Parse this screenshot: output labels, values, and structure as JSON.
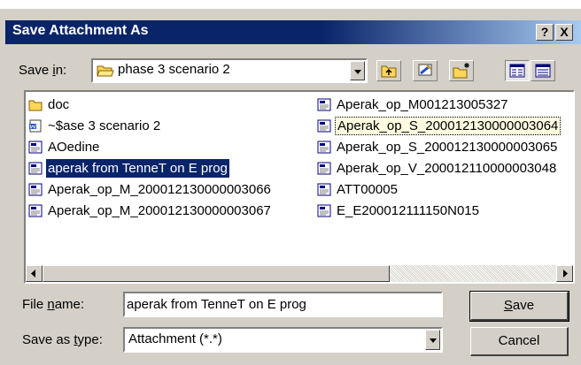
{
  "window": {
    "title": "Save Attachment As",
    "help_label": "?",
    "close_label": "X"
  },
  "save_in": {
    "label_pre": "Save ",
    "label_key": "i",
    "label_post": "n:",
    "value": "phase 3 scenario 2"
  },
  "toolbar": {
    "icons": [
      "up-one-level-icon",
      "desktop-icon",
      "new-folder-icon",
      "list-view-icon",
      "details-view-icon"
    ]
  },
  "files": {
    "left_column": [
      {
        "name": "doc",
        "icon": "folder-icon"
      },
      {
        "name": "~$ase 3 scenario 2",
        "icon": "word-document-icon"
      },
      {
        "name": "AOedine",
        "icon": "message-icon"
      },
      {
        "name": "aperak from TenneT on E prog",
        "icon": "message-icon",
        "selected": true
      },
      {
        "name": "Aperak_op_M_200012130000003066",
        "icon": "message-icon"
      },
      {
        "name": "Aperak_op_M_200012130000003067",
        "icon": "message-icon"
      }
    ],
    "right_column": [
      {
        "name": "Aperak_op_M001213005327",
        "icon": "message-icon"
      },
      {
        "name": "Aperak_op_S_200012130000003064",
        "icon": "message-icon",
        "focused": true
      },
      {
        "name": "Aperak_op_S_200012130000003065",
        "icon": "message-icon"
      },
      {
        "name": "Aperak_op_V_200012110000003048",
        "icon": "message-icon"
      },
      {
        "name": "ATT00005",
        "icon": "message-icon"
      },
      {
        "name": "E_E200012111150N015",
        "icon": "message-icon"
      }
    ]
  },
  "file_name": {
    "label_pre": "File ",
    "label_key": "n",
    "label_post": "ame:",
    "value": "aperak from TenneT on E prog"
  },
  "save_as_type": {
    "label_pre": "Save as ",
    "label_key": "t",
    "label_post": "ype:",
    "value": "Attachment (*.*)"
  },
  "buttons": {
    "save_key": "S",
    "save_rest": "ave",
    "cancel": "Cancel"
  },
  "colors": {
    "title_bar": "#0a246a",
    "selection": "#0a246a",
    "dialog_face": "#d4d0c8"
  }
}
